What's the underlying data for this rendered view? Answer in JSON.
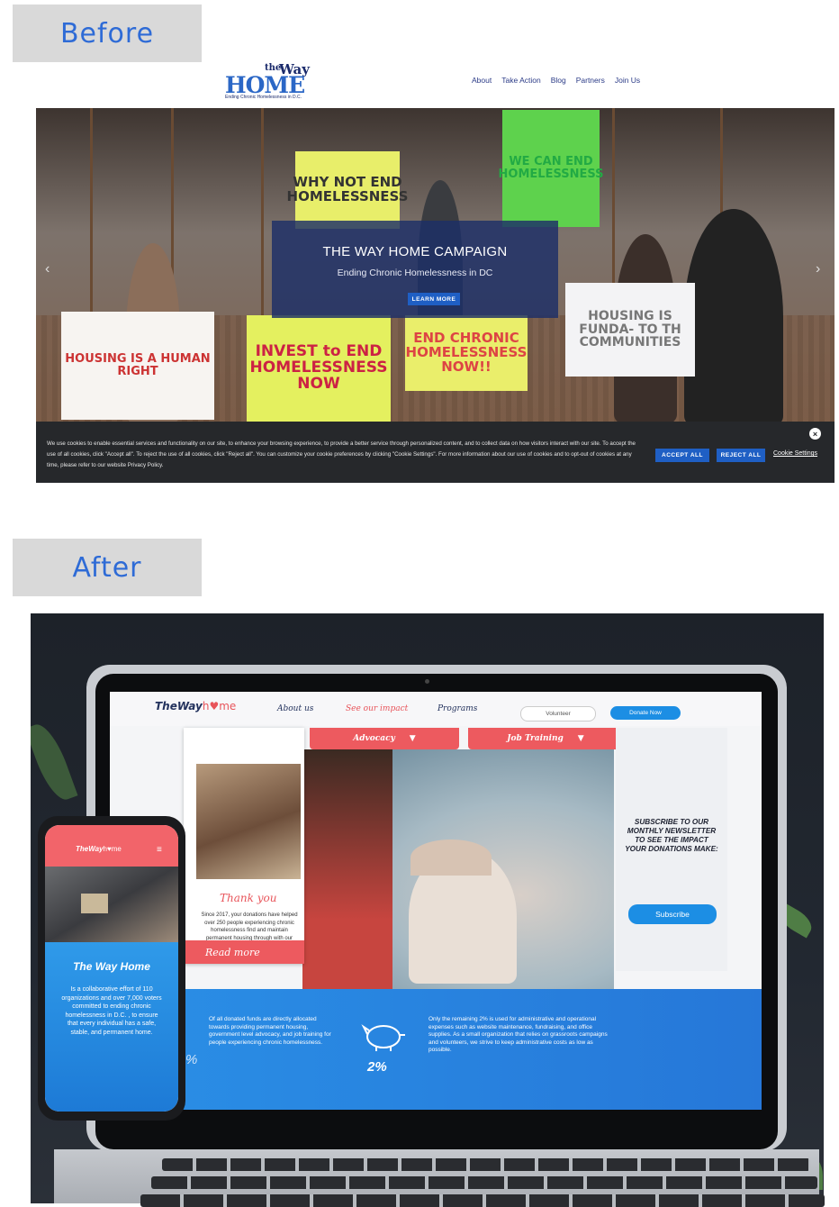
{
  "labels": {
    "before": "Before",
    "after": "After"
  },
  "before": {
    "logo": {
      "the": "the",
      "way": "Way",
      "home": "HOME",
      "tagline": "Ending Chronic Homelessness in D.C."
    },
    "nav": [
      "About",
      "Take Action",
      "Blog",
      "Partners",
      "Join Us"
    ],
    "hero": {
      "title": "THE WAY HOME CAMPAIGN",
      "subtitle": "Ending Chronic Homelessness in DC",
      "button": "LEARN MORE",
      "signs": [
        "WHY NOT END HOMELESSNESS",
        "WE CAN END HOMELESSNESS",
        "HOUSING IS A HUMAN RIGHT",
        "INVEST to END HOMELESSNESS NOW",
        "END CHRONIC HOMELESSNESS NOW!!",
        "HOUSING IS FUNDA- TO TH COMMUNITIES"
      ]
    },
    "cookie": {
      "text": "We use cookies to enable essential services and functionality on our site, to enhance your browsing experience, to provide a better service through personalized content, and to collect data on how visitors interact with our site. To accept the use of all cookies, click \"Accept all\". To reject the use of all cookies, click \"Reject all\". You can customize your cookie preferences by clicking \"Cookie Settings\". For more information about our use of cookies and to opt-out of cookies at any time, please refer to our website Privacy Policy.",
      "accept": "ACCEPT ALL",
      "reject": "REJECT ALL",
      "settings": "Cookie Settings",
      "close": "×"
    }
  },
  "after": {
    "desktop": {
      "logo": {
        "a": "TheWay",
        "b": "h♥me"
      },
      "nav": [
        "About us",
        "See our impact",
        "Programs"
      ],
      "volunteer": "Volunteer",
      "donate": "Donate Now",
      "tabs": [
        "Advocacy",
        "Job Training"
      ],
      "card": {
        "title": "Thank you",
        "text": "Since 2017, your donations have helped over 250 people experiencing chronic homelessness find and maintain permanent housing through with our housing program.",
        "cta": "Read more"
      },
      "subscribe": {
        "heading": "SUBSCRIBE TO OUR MONTHLY NEWSLETTER TO SEE THE IMPACT YOUR DONATIONS MAKE:",
        "button": "Subscribe"
      },
      "band": {
        "left": "Of all donated funds are directly allocated towards providing permanent housing, government level advocacy, and job training for people experiencing chronic homelessness.",
        "left_pct": "%",
        "right": "Only the remaining 2% is used for administrative and operational expenses such as website maintenance, fundraising, and office supplies. As a small organization that relies on grassroots campaigns and volunteers, we strive to keep administrative costs as low as possible.",
        "right_pct": "2%"
      }
    },
    "mobile": {
      "logo": {
        "a": "TheWay",
        "b": "h♥me"
      },
      "menu": "≡",
      "title": "The Way Home",
      "text": "Is a collaborative effort of 110 organizations and over 7,000 voters committed to ending chronic homelessness in D.C. , to ensure that every individual has a safe, stable, and permanent home."
    }
  }
}
